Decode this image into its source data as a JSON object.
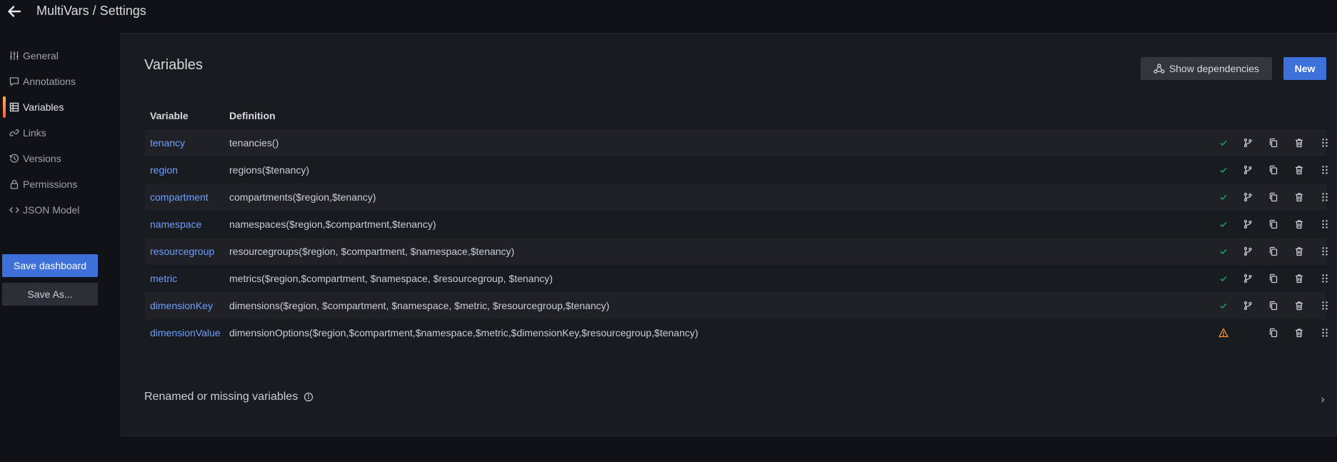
{
  "header": {
    "breadcrumb": "MultiVars / Settings"
  },
  "sidebar": {
    "items": [
      {
        "label": "General",
        "icon": "sliders-icon"
      },
      {
        "label": "Annotations",
        "icon": "comment-icon"
      },
      {
        "label": "Variables",
        "icon": "table-icon",
        "active": true
      },
      {
        "label": "Links",
        "icon": "link-icon"
      },
      {
        "label": "Versions",
        "icon": "history-icon"
      },
      {
        "label": "Permissions",
        "icon": "lock-icon"
      },
      {
        "label": "JSON Model",
        "icon": "code-icon"
      }
    ],
    "save_label": "Save dashboard",
    "save_as_label": "Save As..."
  },
  "main": {
    "title": "Variables",
    "show_dependencies_label": "Show dependencies",
    "new_label": "New",
    "columns": {
      "variable": "Variable",
      "definition": "Definition"
    },
    "rows": [
      {
        "name": "tenancy",
        "definition": "tenancies()",
        "status": "ok"
      },
      {
        "name": "region",
        "definition": "regions($tenancy)",
        "status": "ok"
      },
      {
        "name": "compartment",
        "definition": "compartments($region,$tenancy)",
        "status": "ok"
      },
      {
        "name": "namespace",
        "definition": "namespaces($region,$compartment,$tenancy)",
        "status": "ok"
      },
      {
        "name": "resourcegroup",
        "definition": "resourcegroups($region, $compartment, $namespace,$tenancy)",
        "status": "ok"
      },
      {
        "name": "metric",
        "definition": "metrics($region,$compartment, $namespace, $resourcegroup, $tenancy)",
        "status": "ok"
      },
      {
        "name": "dimensionKey",
        "definition": "dimensions($region, $compartment, $namespace, $metric, $resourcegroup,$tenancy)",
        "status": "ok"
      },
      {
        "name": "dimensionValue",
        "definition": "dimensionOptions($region,$compartment,$namespace,$metric,$dimensionKey,$resourcegroup,$tenancy)",
        "status": "warning"
      }
    ],
    "renamed_label": "Renamed or missing variables"
  },
  "colors": {
    "accent": "#3d71d9",
    "link": "#6e9fff",
    "ok": "#1a9b5e",
    "warning": "#ff9830"
  }
}
